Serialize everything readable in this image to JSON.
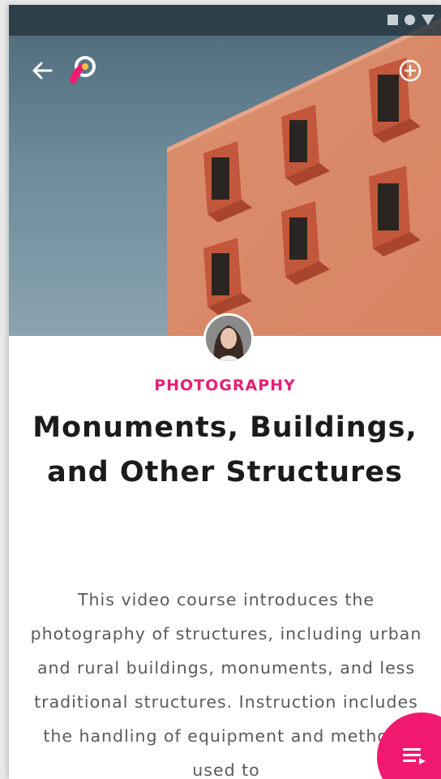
{
  "status_bar": {
    "icons": [
      "square-icon",
      "circle-icon",
      "triangle-icon"
    ]
  },
  "header": {
    "back_icon": "arrow-left-icon",
    "logo_icon": "app-logo-icon",
    "add_icon": "plus-circle-icon"
  },
  "course": {
    "category": "PHOTOGRAPHY",
    "title": "Monuments, Buildings, and Other Structures",
    "description": "This video course introduces the photography of structures, including urban and rural buildings, monuments, and less traditional structures. Instruction includes the handling of equipment and methods used to"
  },
  "fab": {
    "icon": "playlist-icon"
  },
  "colors": {
    "accent": "#e91e74",
    "sky": "#6e8c9c",
    "building": "#d98a68",
    "window_frame": "#c3573b"
  }
}
